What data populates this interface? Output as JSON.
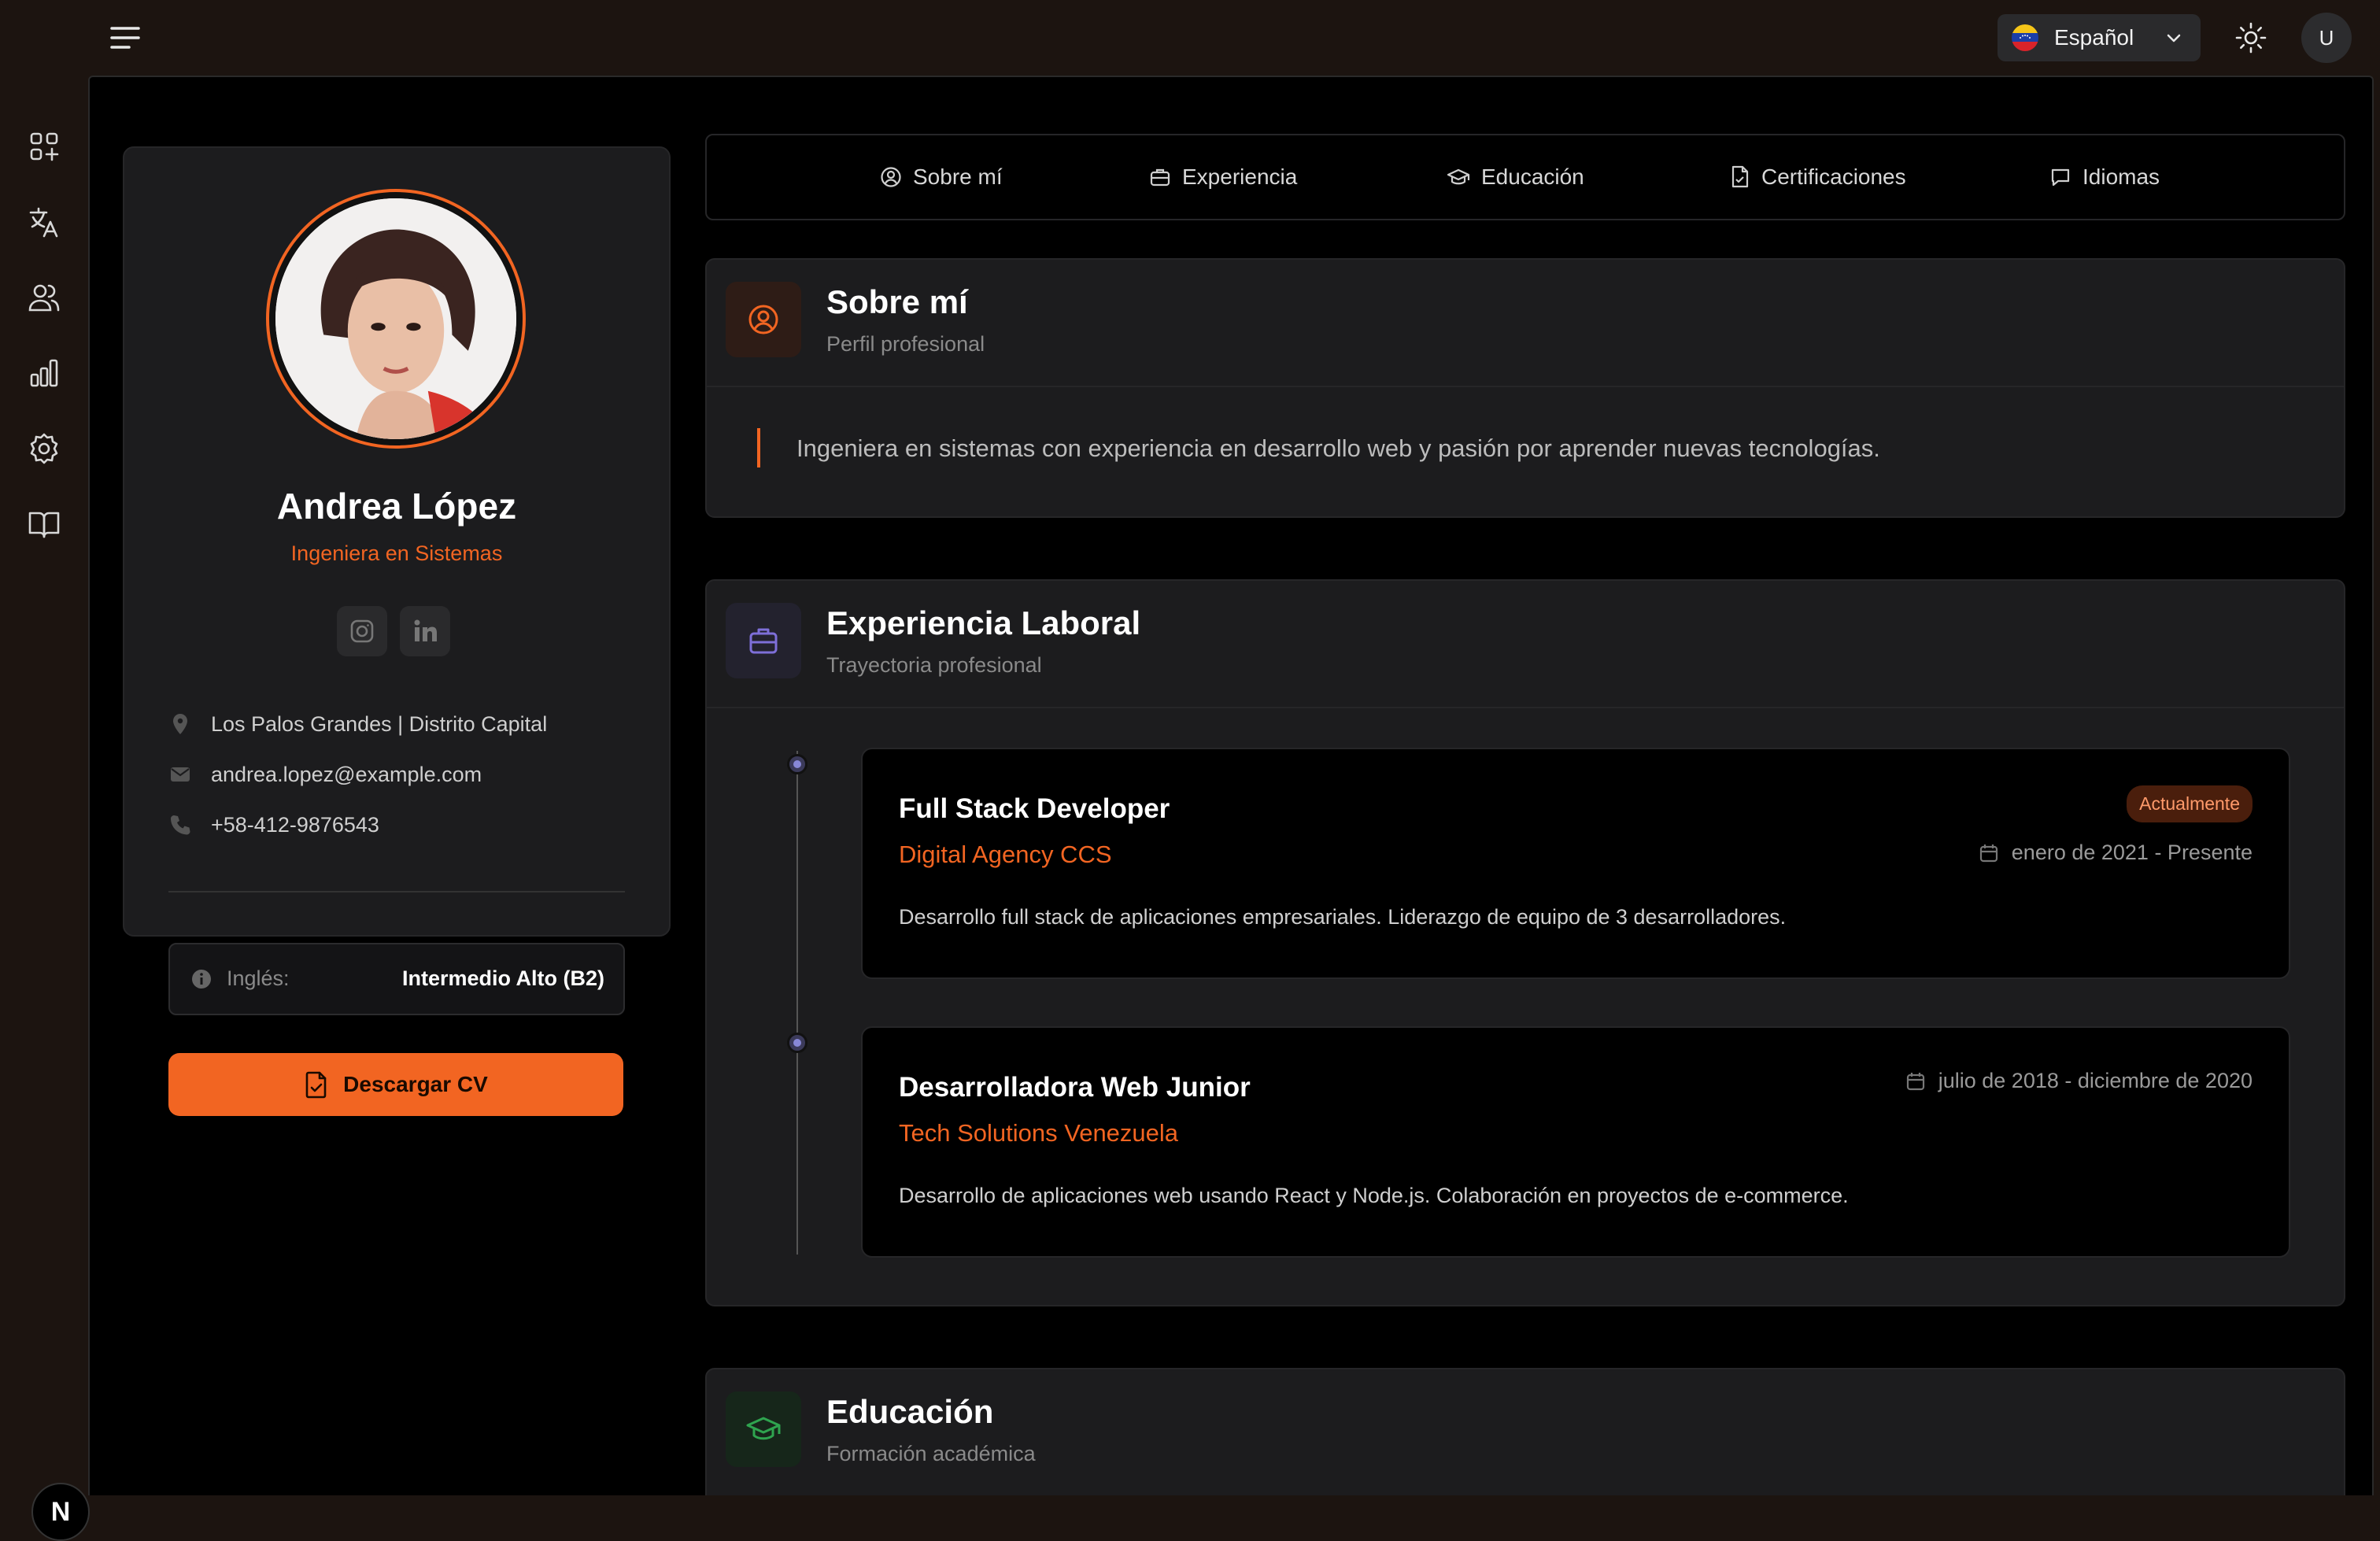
{
  "header": {
    "language": "Español",
    "avatar_initial": "U"
  },
  "sidebar": {
    "items": [
      "apps-icon",
      "translate-icon",
      "users-icon",
      "chart-icon",
      "settings-icon",
      "book-icon"
    ],
    "badge": "N"
  },
  "profile": {
    "name": "Andrea López",
    "role": "Ingeniera en Sistemas",
    "location": "Los Palos Grandes | Distrito Capital",
    "email": "andrea.lopez@example.com",
    "phone": "+58-412-9876543",
    "language_label": "Inglés:",
    "language_value": "Intermedio Alto (B2)",
    "download_label": "Descargar CV"
  },
  "tabs": [
    {
      "label": "Sobre mí",
      "icon": "user-circle-icon"
    },
    {
      "label": "Experiencia",
      "icon": "briefcase-icon"
    },
    {
      "label": "Educación",
      "icon": "graduation-cap-icon"
    },
    {
      "label": "Certificaciones",
      "icon": "file-check-icon"
    },
    {
      "label": "Idiomas",
      "icon": "message-icon"
    }
  ],
  "about": {
    "title": "Sobre mí",
    "subtitle": "Perfil profesional",
    "text": "Ingeniera en sistemas con experiencia en desarrollo web y pasión por aprender nuevas tecnologías."
  },
  "experience": {
    "title": "Experiencia Laboral",
    "subtitle": "Trayectoria profesional",
    "jobs": [
      {
        "title": "Full Stack Developer",
        "company": "Digital Agency CCS",
        "badge": "Actualmente",
        "dates": "enero de 2021 - Presente",
        "description": "Desarrollo full stack de aplicaciones empresariales. Liderazgo de equipo de 3 desarrolladores."
      },
      {
        "title": "Desarrolladora Web Junior",
        "company": "Tech Solutions Venezuela",
        "dates": "julio de 2018 - diciembre de 2020",
        "description": "Desarrollo de aplicaciones web usando React y Node.js. Colaboración en proyectos de e-commerce."
      }
    ]
  },
  "education": {
    "title": "Educación",
    "subtitle": "Formación académica"
  },
  "colors": {
    "accent": "#f26522",
    "background": "#000000",
    "card": "#1c1c1e"
  }
}
